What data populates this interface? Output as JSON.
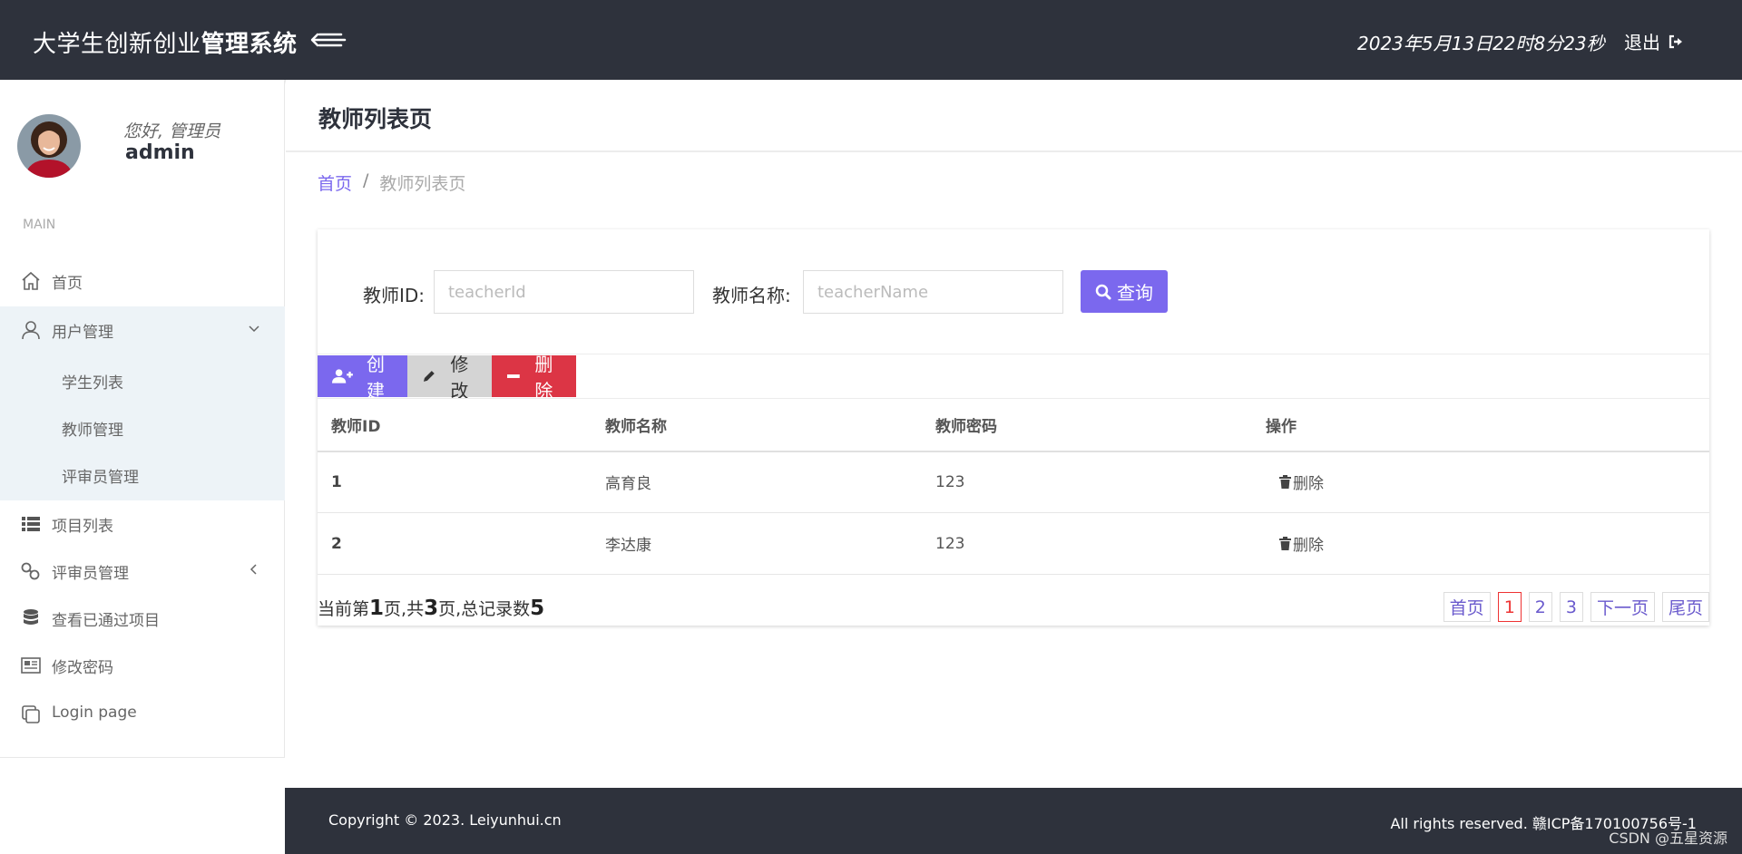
{
  "header": {
    "brand_prefix": "大学生创新创业",
    "brand_bold": "管理系统",
    "datetime": "2023年5月13日22时8分23秒",
    "logout_label": "退出"
  },
  "sidebar": {
    "greeting": "您好, 管理员",
    "username": "admin",
    "section": "MAIN",
    "items": [
      {
        "label": "首页"
      },
      {
        "label": "用户管理"
      },
      {
        "label": "项目列表"
      },
      {
        "label": "评审员管理"
      },
      {
        "label": "查看已通过项目"
      },
      {
        "label": "修改密码"
      },
      {
        "label": "Login page"
      }
    ],
    "user_submenu": [
      {
        "label": "学生列表"
      },
      {
        "label": "教师管理"
      },
      {
        "label": "评审员管理"
      }
    ]
  },
  "page": {
    "title": "教师列表页",
    "breadcrumb_home": "首页",
    "breadcrumb_sep": "/",
    "breadcrumb_current": "教师列表页"
  },
  "search": {
    "id_label": "教师ID:",
    "id_placeholder": "teacherId",
    "name_label": "教师名称:",
    "name_placeholder": "teacherName",
    "query_label": "查询"
  },
  "toolbar": {
    "create_label": "创建",
    "edit_label": "修改",
    "delete_label": "删除"
  },
  "table": {
    "columns": [
      "教师ID",
      "教师名称",
      "教师密码",
      "操作"
    ],
    "rows": [
      {
        "id": "1",
        "name": "高育良",
        "password": "123",
        "action": "删除"
      },
      {
        "id": "2",
        "name": "李达康",
        "password": "123",
        "action": "删除"
      }
    ]
  },
  "pagination": {
    "text_a": "当前第",
    "current": "1",
    "text_b": "页,共",
    "total_pages": "3",
    "text_c": "页,总记录数",
    "total_records": "5",
    "first": "首页",
    "pages": [
      "1",
      "2",
      "3"
    ],
    "next": "下一页",
    "last": "尾页"
  },
  "footer": {
    "copyright": "Copyright © 2023. Leiyunhui.cn",
    "rights": "All rights reserved. 赣ICP备170100756号-1"
  },
  "watermark": "CSDN @五星资源"
}
